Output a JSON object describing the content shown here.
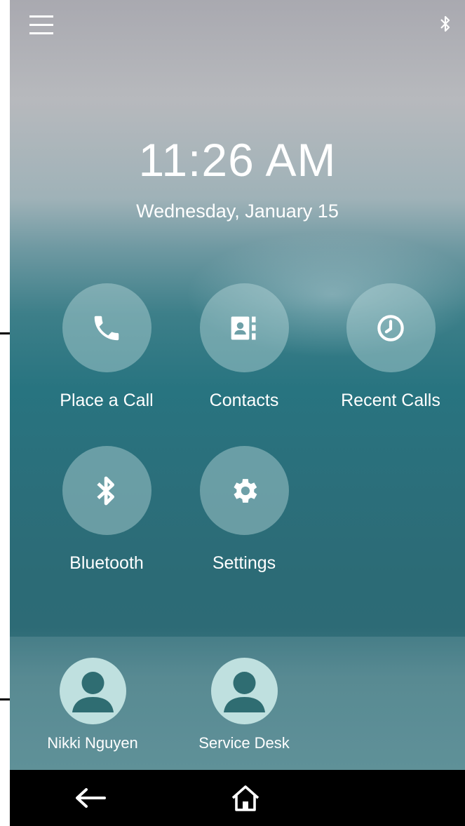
{
  "status_bar": {
    "menu_icon": "hamburger-menu-icon",
    "bluetooth_icon": "bluetooth-icon"
  },
  "clock": {
    "time": "11:26 AM",
    "date": "Wednesday, January 15"
  },
  "tiles": [
    {
      "label": "Place a Call",
      "icon": "phone-icon"
    },
    {
      "label": "Contacts",
      "icon": "contacts-icon"
    },
    {
      "label": "Recent Calls",
      "icon": "clock-icon"
    },
    {
      "label": "Bluetooth",
      "icon": "bluetooth-icon"
    },
    {
      "label": "Settings",
      "icon": "gear-icon"
    }
  ],
  "favorites": [
    {
      "label": "Nikki Nguyen",
      "icon": "person-icon"
    },
    {
      "label": "Service Desk",
      "icon": "person-icon"
    }
  ],
  "nav": {
    "back_icon": "back-arrow-icon",
    "home_icon": "home-icon"
  },
  "colors": {
    "tile_circle": "#b9d7da",
    "avatar_bg": "#bfe0df",
    "avatar_fg": "#2f6d72",
    "navbar": "#000000"
  }
}
